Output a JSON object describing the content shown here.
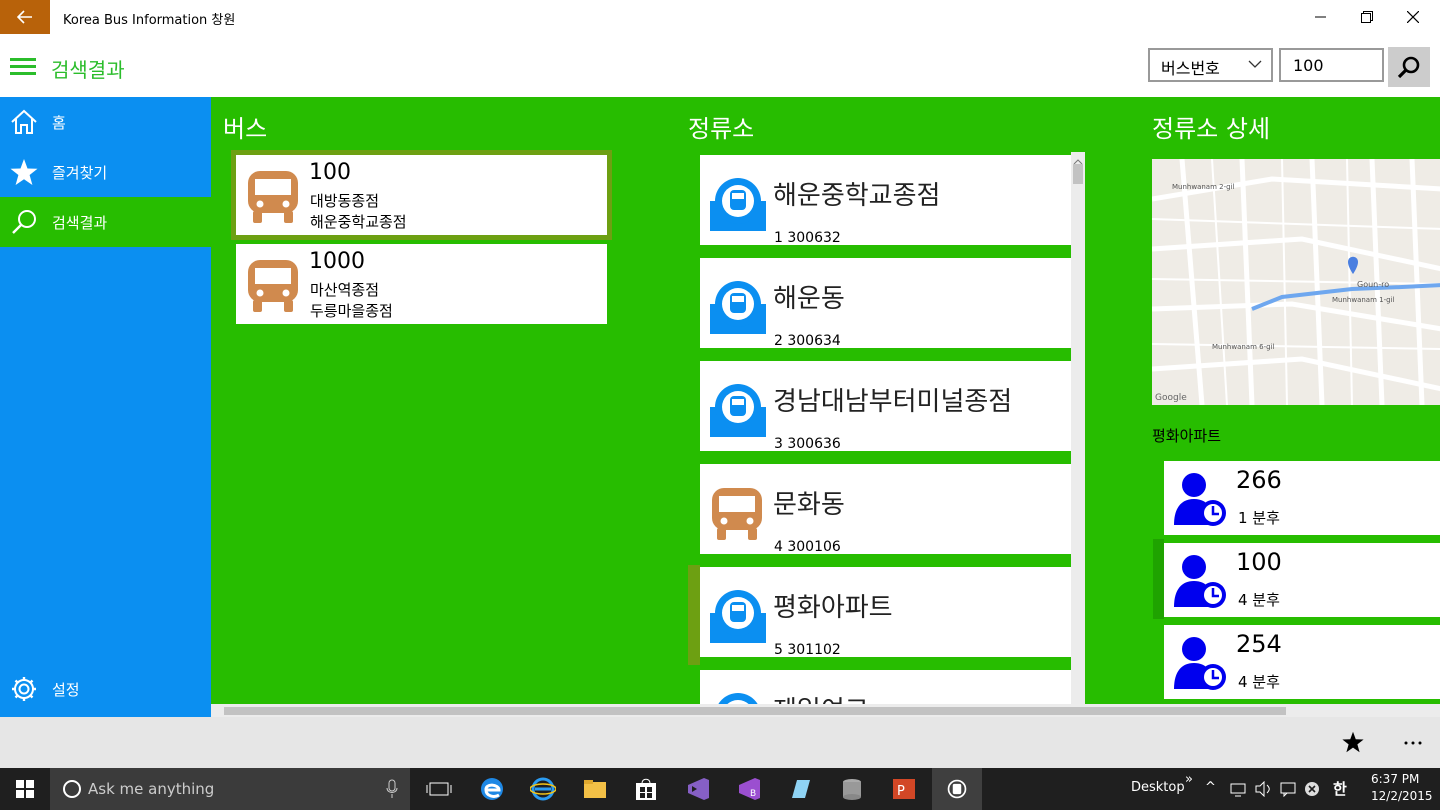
{
  "app": {
    "title": "Korea Bus Information 창원",
    "page_title": "검색결과"
  },
  "search": {
    "type_selected": "버스번호",
    "query": "100"
  },
  "nav": {
    "home": "홈",
    "favorites": "즐겨찾기",
    "results": "검색결과",
    "settings": "설정"
  },
  "columns": {
    "bus": "버스",
    "stops": "정류소",
    "detail": "정류소 상세"
  },
  "buses": [
    {
      "number": "100",
      "from": "대방동종점",
      "to": "해운중학교종점"
    },
    {
      "number": "1000",
      "from": "마산역종점",
      "to": "두릉마을종점"
    }
  ],
  "stops": [
    {
      "name": "해운중학교종점",
      "id": "1 300632",
      "icon": "bus-stop-icon"
    },
    {
      "name": "해운동",
      "id": "2 300634",
      "icon": "bus-stop-icon"
    },
    {
      "name": "경남대남부터미널종점",
      "id": "3 300636",
      "icon": "bus-stop-icon"
    },
    {
      "name": "문화동",
      "id": "4 300106",
      "icon": "bus-icon"
    },
    {
      "name": "평화아파트",
      "id": "5 301102",
      "icon": "bus-stop-icon"
    },
    {
      "name": "제일여고",
      "id": "",
      "icon": "bus-stop-icon"
    }
  ],
  "detail": {
    "stop_name": "평화아파트",
    "map": {
      "labels": [
        "Goun-ro",
        "Munhwanam 1-gil",
        "Munhwanam 6-gil",
        "Munhwanam 2-gil",
        "Google"
      ]
    },
    "arrivals": [
      {
        "bus": "266",
        "eta": "1 분후"
      },
      {
        "bus": "100",
        "eta": "4 분후"
      },
      {
        "bus": "254",
        "eta": "4 분후"
      }
    ]
  },
  "taskbar": {
    "search_placeholder": "Ask me anything",
    "desktop": "Desktop",
    "time": "6:37 PM",
    "date": "12/2/2015"
  },
  "colors": {
    "green": "#27bd00",
    "blue": "#0b8ff1",
    "orange_bus": "#d08a4e",
    "stop_blue": "#0b8ff1",
    "arrival_icon": "#0000ee"
  }
}
